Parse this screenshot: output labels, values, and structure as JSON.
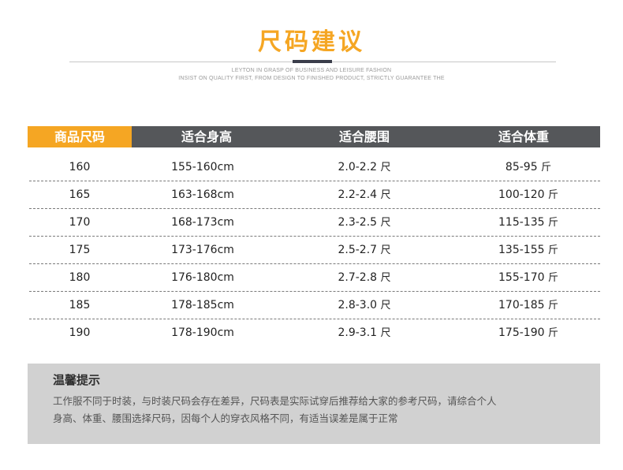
{
  "header": {
    "title": "尺码建议",
    "tagline_1": "LEYTON IN GRASP OF BUSINESS AND LEISURE FASHION",
    "tagline_2": "INSIST ON QUALITY FIRST, FROM DESIGN TO FINISHED PRODUCT, STRICTLY GUARANTEE THE"
  },
  "table": {
    "columns": [
      "商品尺码",
      "适合身高",
      "适合腰围",
      "适合体重"
    ],
    "rows": [
      {
        "size": "160",
        "height": "155-160cm",
        "waist": "2.0-2.2",
        "waist_unit": "尺",
        "weight": "85-95",
        "weight_unit": "斤"
      },
      {
        "size": "165",
        "height": "163-168cm",
        "waist": "2.2-2.4",
        "waist_unit": "尺",
        "weight": "100-120",
        "weight_unit": "斤"
      },
      {
        "size": "170",
        "height": "168-173cm",
        "waist": "2.3-2.5",
        "waist_unit": "尺",
        "weight": "115-135",
        "weight_unit": "斤"
      },
      {
        "size": "175",
        "height": "173-176cm",
        "waist": "2.5-2.7",
        "waist_unit": "尺",
        "weight": "135-155",
        "weight_unit": "斤"
      },
      {
        "size": "180",
        "height": "176-180cm",
        "waist": "2.7-2.8",
        "waist_unit": "尺",
        "weight": "155-170",
        "weight_unit": "斤"
      },
      {
        "size": "185",
        "height": "178-185cm",
        "waist": "2.8-3.0",
        "waist_unit": "尺",
        "weight": "170-185",
        "weight_unit": "斤"
      },
      {
        "size": "190",
        "height": "178-190cm",
        "waist": "2.9-3.1",
        "waist_unit": "尺",
        "weight": "175-190",
        "weight_unit": "斤"
      }
    ]
  },
  "notice": {
    "title": "温馨提示",
    "line_1": "工作服不同于时装，与时装尺码会存在差异，尺码表是实际试穿后推荐给大家的参考尺码，请综合个人",
    "line_2": "身高、体重、腰围选择尺码，因每个人的穿衣风格不同，有适当误差是属于正常"
  },
  "colors": {
    "accent": "#f5a623",
    "header_bg": "#55575a",
    "notice_bg": "#d1d1d1"
  }
}
